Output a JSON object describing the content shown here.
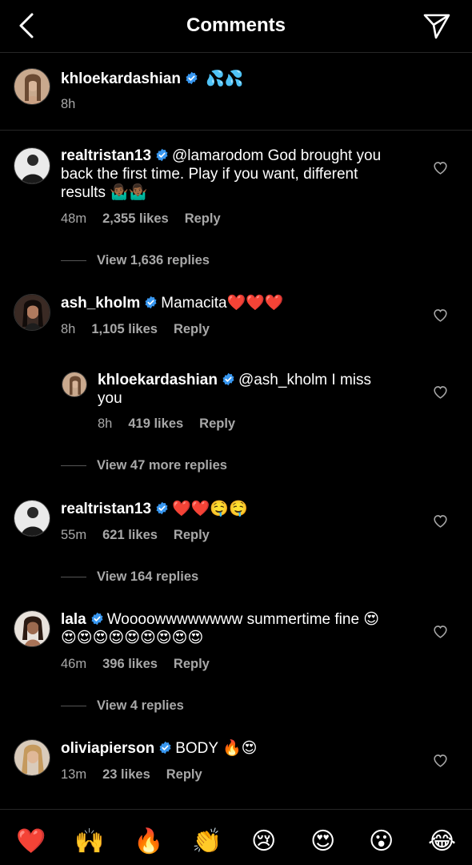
{
  "header": {
    "title": "Comments",
    "back_icon": "chevron-left-icon",
    "send_icon": "paper-plane-icon"
  },
  "caption": {
    "username": "khloekardashian",
    "text": "💦💦",
    "time": "8h"
  },
  "comments": [
    {
      "username": "realtristan13",
      "text": "@lamarodom God brought you back the first time. Play if you want, different results 🤷🏾‍♂️🤷🏾‍♂️",
      "line_a": "@lamarodom God brought you",
      "line_b": "back the first time. Play if you want, different",
      "line_c": "results 🤷🏾‍♂️🤷🏾‍♂️",
      "time": "48m",
      "likes": "2,355 likes",
      "reply": "Reply",
      "view_replies": "View 1,636 replies"
    },
    {
      "username": "ash_kholm",
      "text": "Mamacita❤️❤️❤️",
      "time": "8h",
      "likes": "1,105 likes",
      "reply": "Reply"
    },
    {
      "username": "khloekardashian",
      "line_a": "@ash_kholm I miss",
      "line_b": "you",
      "time": "8h",
      "likes": "419 likes",
      "reply": "Reply",
      "view_replies": "View 47 more replies"
    },
    {
      "username": "realtristan13",
      "text": "❤️❤️🤤🤤",
      "time": "55m",
      "likes": "621 likes",
      "reply": "Reply",
      "view_replies": "View 164 replies"
    },
    {
      "username": "lala",
      "line_a": "Woooowwwwwwww summertime fine 😍",
      "line_b": "😍😍😍😍😍😍😍😍😍",
      "time": "46m",
      "likes": "396 likes",
      "reply": "Reply",
      "view_replies": "View 4 replies"
    },
    {
      "username": "oliviapierson",
      "text": "BODY 🔥😍",
      "time": "13m",
      "likes": "23 likes",
      "reply": "Reply"
    }
  ],
  "emoji_bar": [
    "❤️",
    "🙌",
    "🔥",
    "👏",
    "😢",
    "😍",
    "😮",
    "😂"
  ],
  "colors": {
    "background": "#000000",
    "verified": "#3897f0",
    "secondary_text": "#a8a8a8"
  }
}
